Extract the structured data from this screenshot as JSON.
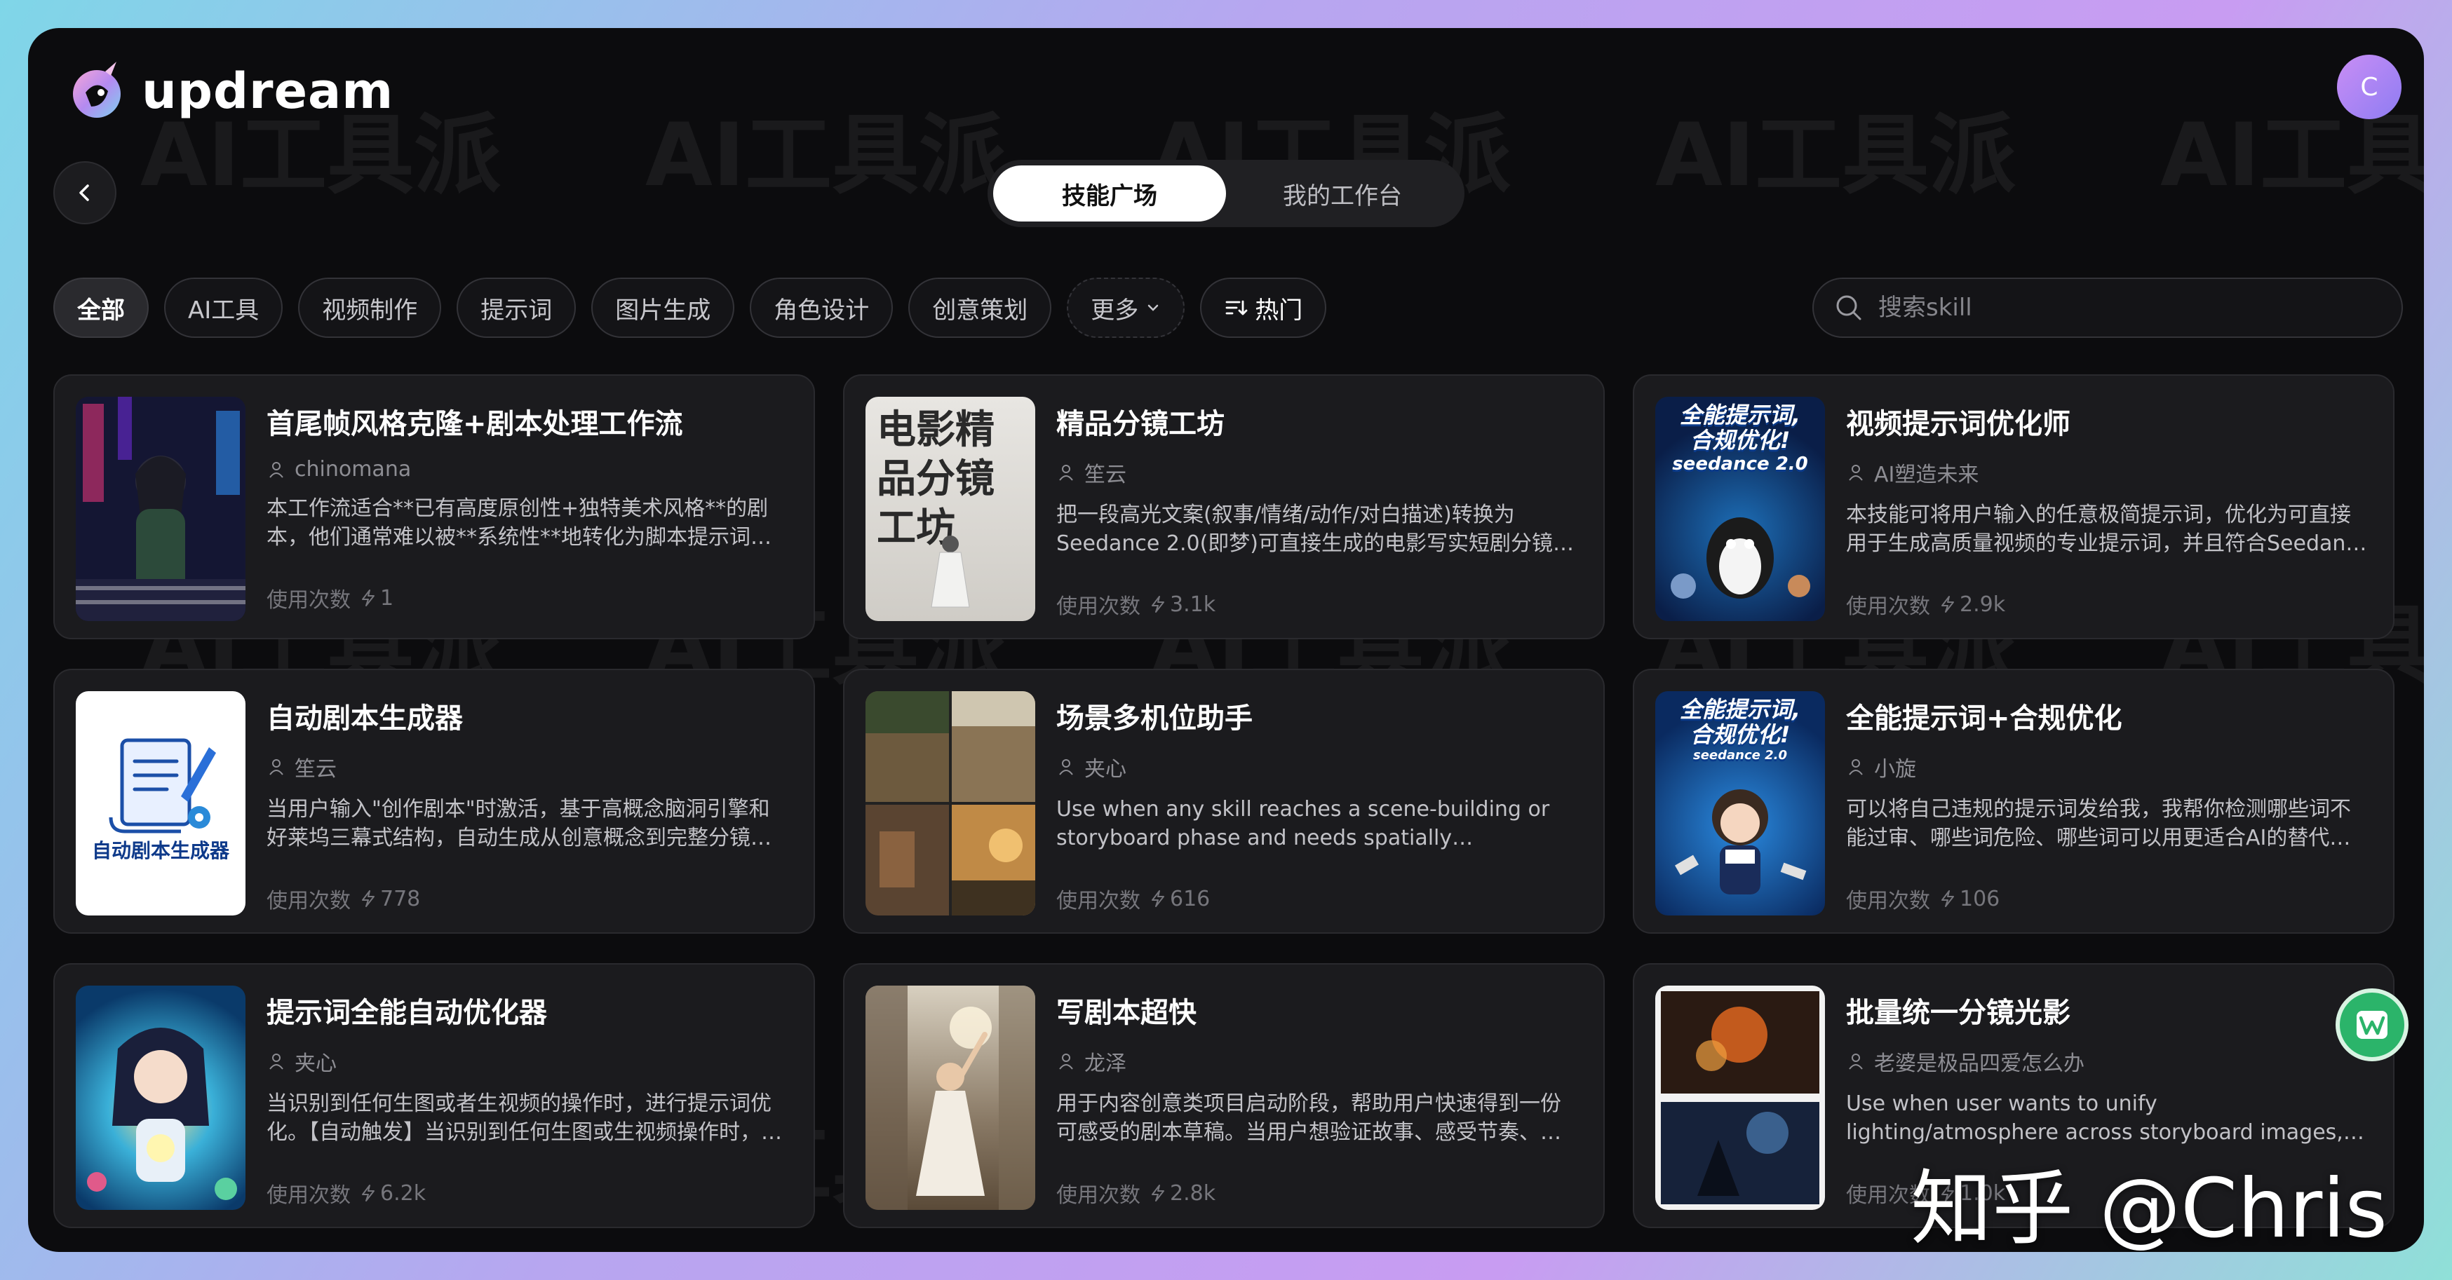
{
  "brand": {
    "name": "updream"
  },
  "user": {
    "avatar_initial": "C"
  },
  "watermark": "AI工具派",
  "tabs": [
    {
      "label": "技能广场",
      "active": true
    },
    {
      "label": "我的工作台",
      "active": false
    }
  ],
  "filters": {
    "chips": [
      "全部",
      "AI工具",
      "视频制作",
      "提示词",
      "图片生成",
      "角色设计",
      "创意策划"
    ],
    "more_label": "更多",
    "sort_label": "热门"
  },
  "search": {
    "placeholder": "搜索skill"
  },
  "usage_label": "使用次数",
  "cards": [
    {
      "title": "首尾帧风格克隆+剧本处理工作流",
      "author": "chinomana",
      "desc": "本工作流适合**已有高度原创性+独特美术风格**的剧本，他们通常难以被**系统性**地转化为脚本提示词…",
      "count": "1"
    },
    {
      "title": "精品分镜工坊",
      "author": "笙云",
      "desc": "把一段高光文案(叙事/情绪/动作/对白描述)转换为Seedance 2.0(即梦)可直接生成的电影写实短剧分镜…",
      "count": "3.1k"
    },
    {
      "title": "视频提示词优化师",
      "author": "AI塑造未来",
      "desc": "本技能可将用户输入的任意极简提示词，优化为可直接用于生成高质量视频的专业提示词，并且符合Seedan…",
      "count": "2.9k"
    },
    {
      "title": "自动剧本生成器",
      "author": "笙云",
      "desc": "当用户输入\"创作剧本\"时激活，基于高概念脑洞引擎和好莱坞三幕式结构，自动生成从创意概念到完整分镜…",
      "count": "778"
    },
    {
      "title": "场景多机位助手",
      "author": "夹心",
      "desc": "Use when any skill reaches a scene-building or storyboard phase and needs spatially consistent…",
      "count": "616"
    },
    {
      "title": "全能提示词+合规优化",
      "author": "小旋",
      "desc": "可以将自己违规的提示词发给我，我帮你检测哪些词不能过审、哪些词危险、哪些词可以用更适合AI的替代…",
      "count": "106"
    },
    {
      "title": "提示词全能自动优化器",
      "author": "夹心",
      "desc": "当识别到任何生图或者生视频的操作时，进行提示词优化。【自动触发】当识别到任何生图或生视频操作时，…",
      "count": "6.2k"
    },
    {
      "title": "写剧本超快",
      "author": "龙泽",
      "desc": "用于内容创意类项目启动阶段，帮助用户快速得到一份可感受的剧本草稿。当用户想验证故事、感受节奏、…",
      "count": "2.8k"
    },
    {
      "title": "批量统一分镜光影",
      "author": "老婆是极品四爱怎么办",
      "desc": "Use when user wants to unify lighting/atmosphere across storyboard images, apply consistent light…",
      "count": "1.0k"
    }
  ],
  "thumbs": {
    "card2_text": "电影精品分镜工坊",
    "card3_text": [
      "全能提示词,",
      "合规优化!",
      "seedance 2.0"
    ],
    "card4_text": "自动剧本生成器",
    "card6_text": [
      "全能提示词,",
      "合规优化!",
      "seedance 2.0"
    ]
  },
  "overlay": {
    "zhihu_text": "知乎 @Chris"
  },
  "colors": {
    "accent_green": "#2bb46a",
    "avatar": "#b58af3",
    "background": "#0c0c0e",
    "card": "#1b1b1e"
  }
}
